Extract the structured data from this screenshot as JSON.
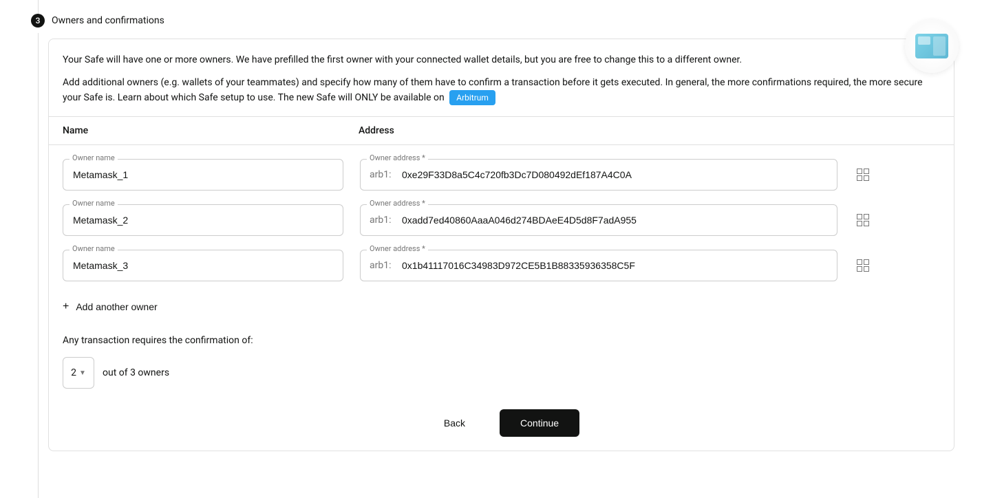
{
  "step": {
    "number": "3",
    "title": "Owners and confirmations"
  },
  "intro": {
    "line1": "Your Safe will have one or more owners. We have prefilled the first owner with your connected wallet details, but you are free to change this to a different owner.",
    "line2": "Add additional owners (e.g. wallets of your teammates) and specify how many of them have to confirm a transaction before it gets executed. In general, the more confirmations required, the more secure your Safe is. Learn about which Safe setup to use. The new Safe will ONLY be available on",
    "chain": "Arbitrum"
  },
  "columns": {
    "name": "Name",
    "address": "Address"
  },
  "labels": {
    "owner_name": "Owner name",
    "owner_address": "Owner address *",
    "prefix": "arb1:"
  },
  "owners": [
    {
      "name": "Metamask_1",
      "address": "0xe29F33D8a5C4c720fb3Dc7D080492dEf187A4C0A",
      "deletable": false
    },
    {
      "name": "Metamask_2",
      "address": "0xadd7ed40860AaaA046d274BDAeE4D5d8F7adA955",
      "deletable": true
    },
    {
      "name": "Metamask_3",
      "address": "0x1b41117016C34983D972CE5B1B88335936358C5F",
      "deletable": true
    }
  ],
  "add_owner": "Add another owner",
  "confirmation": {
    "text": "Any transaction requires the confirmation of:",
    "selected": "2",
    "suffix": "out of 3 owners"
  },
  "buttons": {
    "back": "Back",
    "continue": "Continue"
  }
}
